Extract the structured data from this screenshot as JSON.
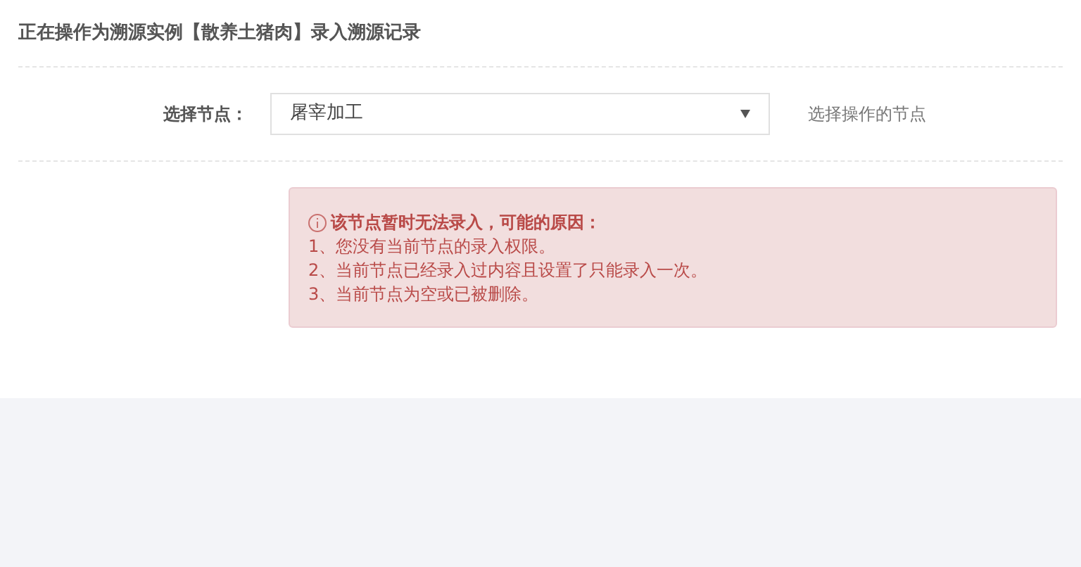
{
  "header": {
    "title": "正在操作为溯源实例【散养土猪肉】录入溯源记录"
  },
  "form": {
    "label": "选择节点：",
    "select": {
      "value": "屠宰加工"
    },
    "help": "选择操作的节点"
  },
  "alert": {
    "title": "该节点暂时无法录入，可能的原因：",
    "lines": [
      "1、您没有当前节点的录入权限。",
      "2、当前节点已经录入过内容且设置了只能录入一次。",
      "3、当前节点为空或已被删除。"
    ]
  }
}
